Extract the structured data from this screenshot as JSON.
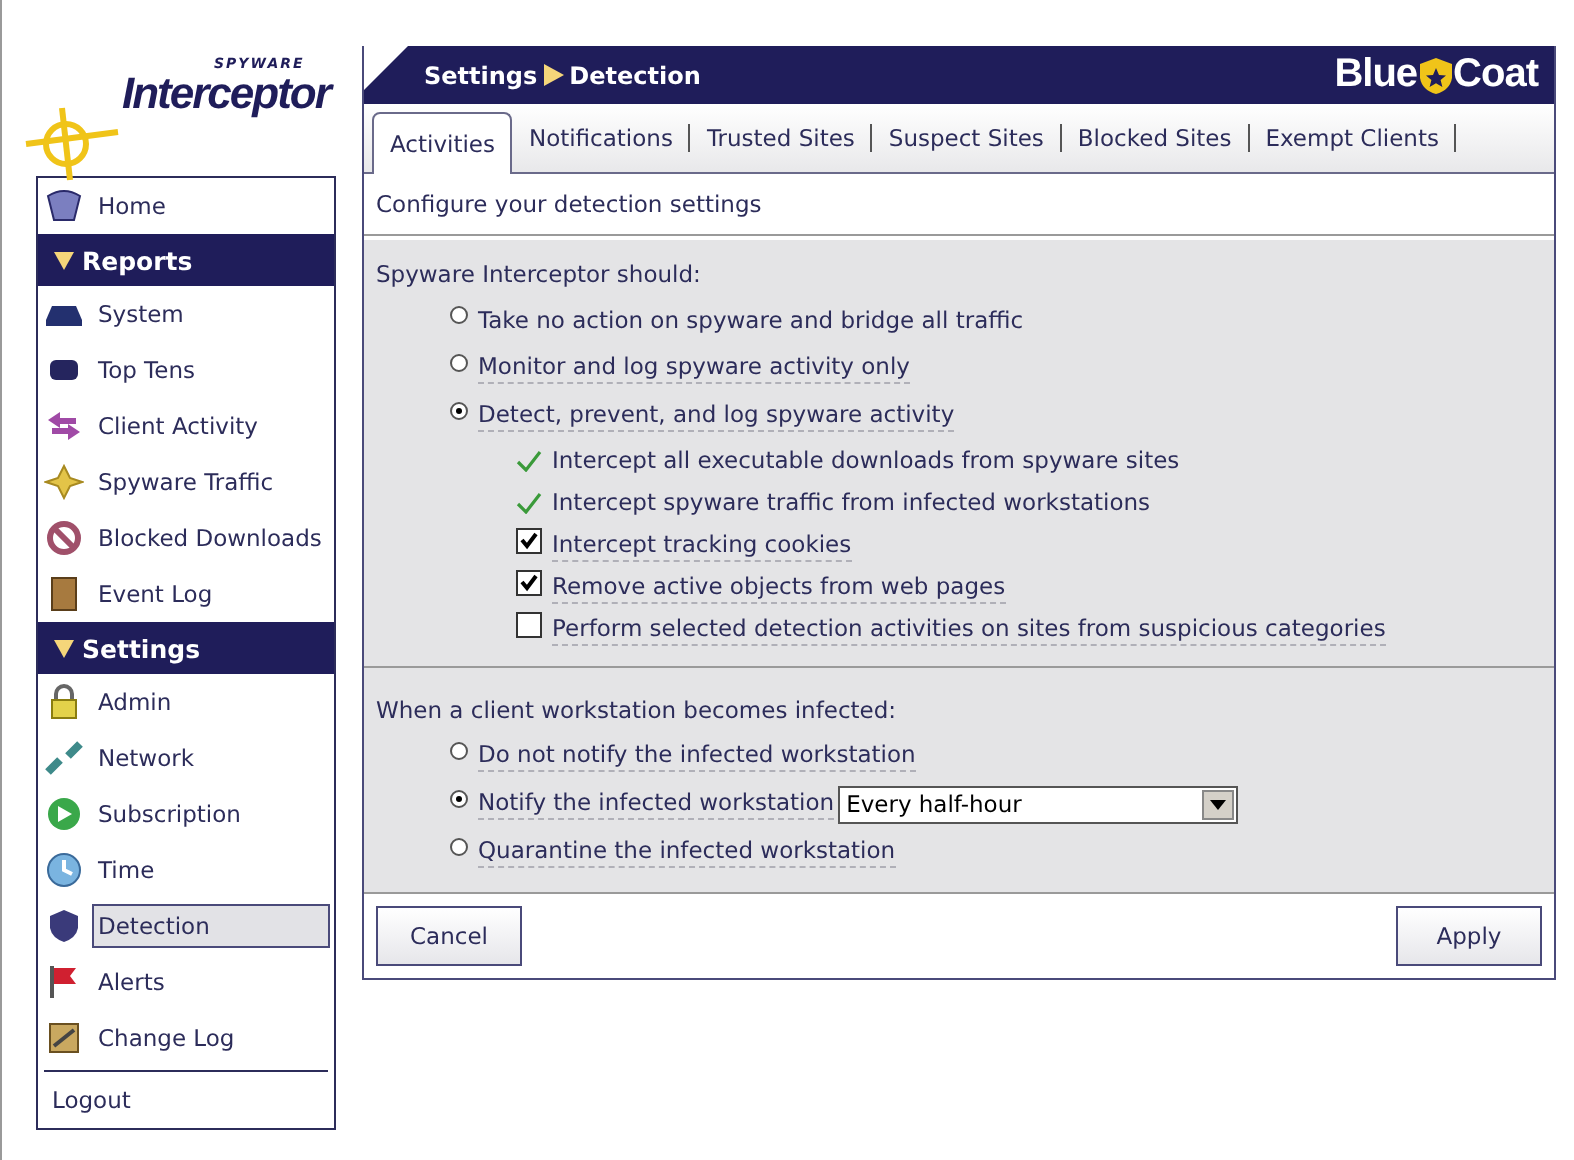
{
  "logo": {
    "tagline": "SPYWARE",
    "name": "Interceptor"
  },
  "sidebar": {
    "items": [
      {
        "kind": "item",
        "label": "Home",
        "selected": false
      },
      {
        "kind": "header",
        "label": "Reports",
        "expanded": true
      },
      {
        "kind": "item",
        "label": "System",
        "selected": false
      },
      {
        "kind": "item",
        "label": "Top Tens",
        "selected": false
      },
      {
        "kind": "item",
        "label": "Client Activity",
        "selected": false
      },
      {
        "kind": "item",
        "label": "Spyware Traffic",
        "selected": false
      },
      {
        "kind": "item",
        "label": "Blocked Downloads",
        "selected": false
      },
      {
        "kind": "item",
        "label": "Event Log",
        "selected": false
      },
      {
        "kind": "header",
        "label": "Settings",
        "expanded": true
      },
      {
        "kind": "item",
        "label": "Admin",
        "selected": false
      },
      {
        "kind": "item",
        "label": "Network",
        "selected": false
      },
      {
        "kind": "item",
        "label": "Subscription",
        "selected": false
      },
      {
        "kind": "item",
        "label": "Time",
        "selected": false
      },
      {
        "kind": "item",
        "label": "Detection",
        "selected": true
      },
      {
        "kind": "item",
        "label": "Alerts",
        "selected": false
      },
      {
        "kind": "item",
        "label": "Change Log",
        "selected": false
      },
      {
        "kind": "logout",
        "label": "Logout"
      }
    ]
  },
  "header": {
    "breadcrumb": [
      "Settings",
      "Detection"
    ],
    "brand": [
      "Blue",
      "Coat"
    ]
  },
  "tabs": [
    {
      "label": "Activities",
      "selected": true
    },
    {
      "label": "Notifications",
      "selected": false
    },
    {
      "label": "Trusted Sites",
      "selected": false
    },
    {
      "label": "Suspect Sites",
      "selected": false
    },
    {
      "label": "Blocked Sites",
      "selected": false
    },
    {
      "label": "Exempt Clients",
      "selected": false
    }
  ],
  "description": "Configure your detection settings",
  "detection": {
    "title": "Spyware Interceptor should:",
    "options": [
      {
        "label": "Take no action on spyware and bridge all traffic",
        "selected": false
      },
      {
        "label": "Monitor and log spyware activity only",
        "selected": false
      },
      {
        "label": "Detect, prevent, and log spyware activity",
        "selected": true
      }
    ],
    "sub_options": [
      {
        "kind": "fixed",
        "label": "Intercept all executable downloads from spyware sites"
      },
      {
        "kind": "fixed",
        "label": "Intercept spyware traffic from infected workstations"
      },
      {
        "kind": "checkbox",
        "label": "Intercept tracking cookies",
        "checked": true
      },
      {
        "kind": "checkbox",
        "label": "Remove active objects from web pages",
        "checked": true
      },
      {
        "kind": "checkbox",
        "label": "Perform selected detection activities on sites from suspicious categories",
        "checked": false
      }
    ]
  },
  "infection": {
    "title": "When a client workstation becomes infected:",
    "options": [
      {
        "label": "Do not notify the infected workstation",
        "selected": false
      },
      {
        "label": "Notify the infected workstation",
        "selected": true,
        "dropdown": "Every half-hour"
      },
      {
        "label": "Quarantine the infected workstation",
        "selected": false
      }
    ]
  },
  "buttons": {
    "cancel": "Cancel",
    "apply": "Apply"
  }
}
